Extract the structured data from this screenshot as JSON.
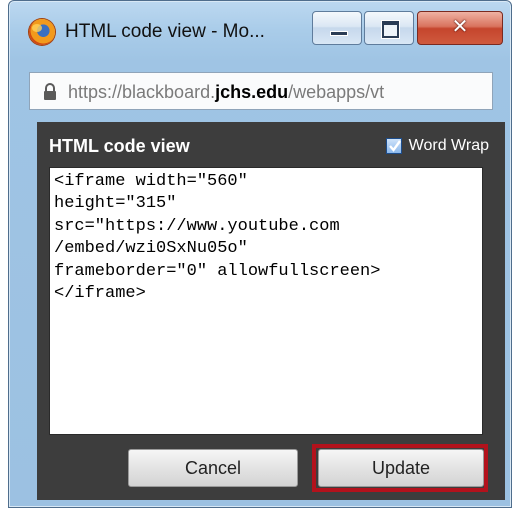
{
  "window": {
    "title": "HTML code view - Mo...",
    "controls": {
      "minimize": "minimize",
      "maximize": "maximize",
      "close": "close"
    }
  },
  "address_bar": {
    "url_prefix": "https://blackboard.",
    "url_domain": "jchs.edu",
    "url_suffix": "/webapps/vt",
    "icon": "lock-icon"
  },
  "dialog": {
    "title": "HTML code view",
    "word_wrap": {
      "label": "Word Wrap",
      "checked": true
    },
    "code": "<iframe width=\"560\"\nheight=\"315\"\nsrc=\"https://www.youtube.com\n/embed/wzi0SxNu05o\"\nframeborder=\"0\" allowfullscreen>\n</iframe>",
    "buttons": {
      "cancel": "Cancel",
      "update": "Update"
    },
    "highlight_color": "#b3121c"
  },
  "colors": {
    "panel_bg": "#3d3d3d",
    "window_frame": "#a9cce9",
    "close_button": "#c5452d"
  }
}
